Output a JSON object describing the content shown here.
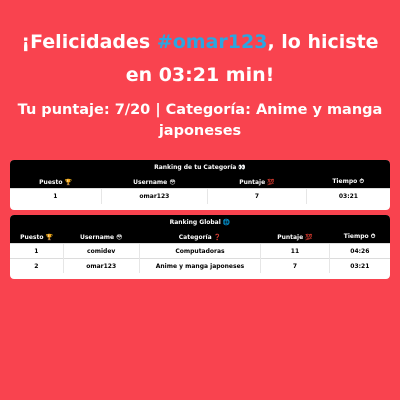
{
  "header": {
    "prefix": "¡Felicidades ",
    "username": "#omar123",
    "suffix": ", lo hiciste en 03:21 min!"
  },
  "score_line": "Tu puntaje: 7/20 | Categoría: Anime y manga japoneses",
  "category_ranking": {
    "title": "Ranking de tu Categoría 👀",
    "columns": [
      "Puesto 🏆",
      "Username 😳",
      "Puntaje 💯",
      "Tiempo ⏱"
    ],
    "rows": [
      [
        "1",
        "omar123",
        "7",
        "03:21"
      ]
    ]
  },
  "global_ranking": {
    "title": "Ranking Global 🌐",
    "columns": [
      "Puesto 🏆",
      "Username 😳",
      "Categoría ❓",
      "Puntaje 💯",
      "Tiempo ⏱"
    ],
    "rows": [
      [
        "1",
        "comidev",
        "Computadoras",
        "11",
        "04:26"
      ],
      [
        "2",
        "omar123",
        "Anime y manga japoneses",
        "7",
        "03:21"
      ]
    ]
  },
  "colors": {
    "background": "#f9434f",
    "accent": "#2ba6e0",
    "table_header": "#000000"
  }
}
